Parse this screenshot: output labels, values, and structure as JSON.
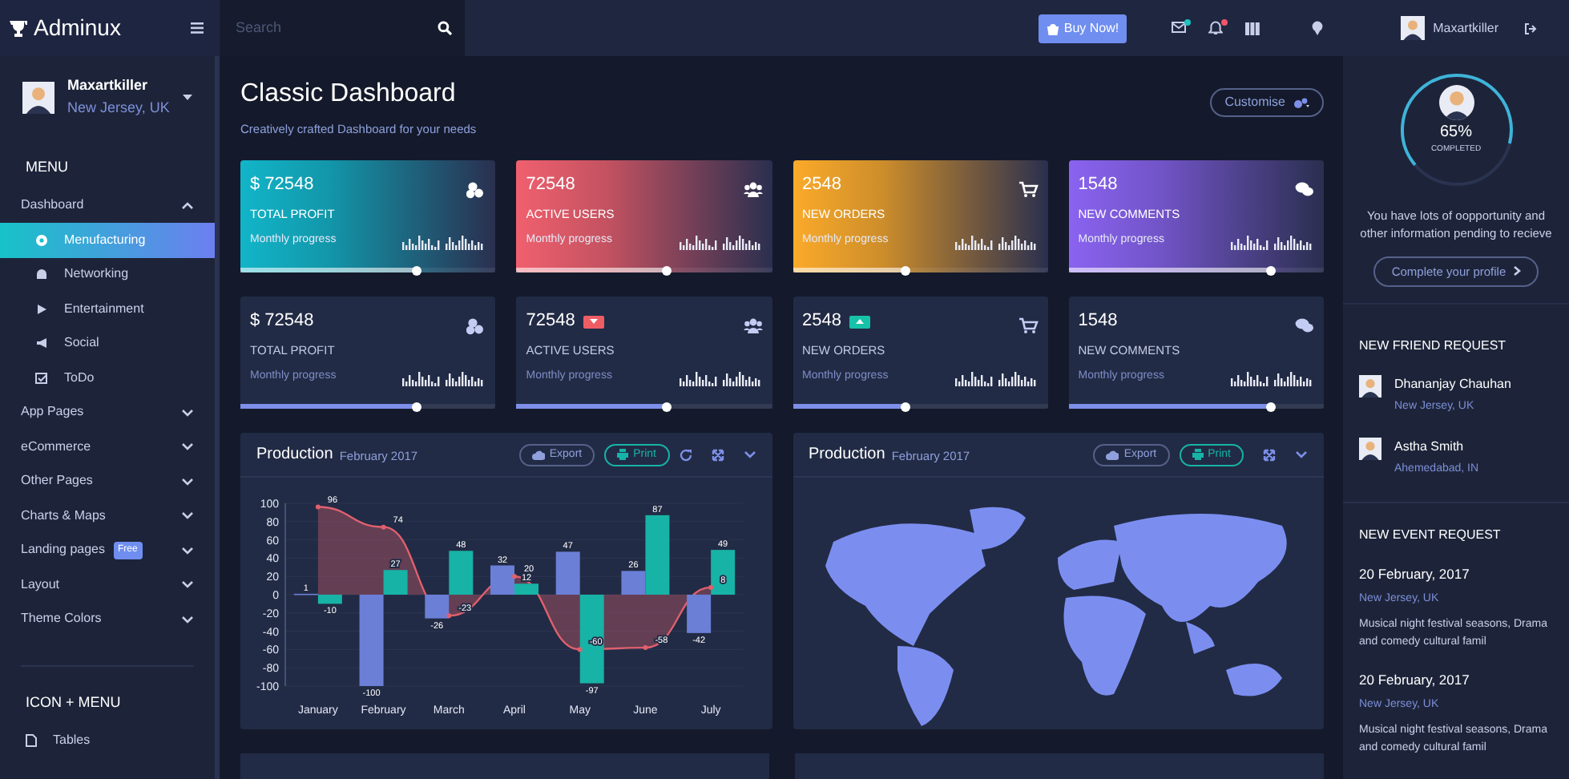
{
  "topbar": {
    "brand": "Adminux",
    "search": {
      "placeholder": "Search"
    },
    "buy_button": "Buy Now!",
    "notifications": [
      {
        "color": "#1bc5bd"
      },
      {
        "color": "#f0556a"
      }
    ],
    "user": "Maxartkiller"
  },
  "sidebar": {
    "user": {
      "name": "Maxartkiller",
      "location": "New Jersey, UK"
    },
    "menu_title": "MENU",
    "items": [
      {
        "label": "Dashboard",
        "expanded": true,
        "children": [
          {
            "label": "Menufacturing",
            "selected": true
          },
          {
            "label": "Networking",
            "selected": false
          },
          {
            "label": "Entertainment",
            "selected": false
          },
          {
            "label": "Social",
            "selected": false
          },
          {
            "label": "ToDo",
            "selected": false
          }
        ]
      },
      {
        "label": "App Pages",
        "expanded": false
      },
      {
        "label": "eCommerce",
        "expanded": false
      },
      {
        "label": "Other Pages",
        "expanded": false
      },
      {
        "label": "Charts & Maps",
        "expanded": false
      },
      {
        "label": "Landing pages",
        "badge": "Free",
        "expanded": false
      },
      {
        "label": "Layout",
        "expanded": false
      },
      {
        "label": "Theme Colors",
        "expanded": false
      }
    ],
    "section_title": "ICON + MENU",
    "icon_items": [
      {
        "label": "Tables"
      }
    ]
  },
  "header": {
    "title": "Classic Dashboard",
    "subtitle": "Creatively crafted Dashboard for your needs",
    "customise_button": "Customise"
  },
  "stats": [
    {
      "kind": "gradient",
      "color": "#12b5c9",
      "value": "$ 72548",
      "label": "TOTAL PROFIT",
      "progress_label": "Monthly progress",
      "level": 0.69
    },
    {
      "kind": "gradient",
      "color": "#f0606e",
      "value": "72548",
      "label": "ACTIVE USERS",
      "progress_label": "Monthly progress",
      "level": 0.59
    },
    {
      "kind": "gradient",
      "color": "#fbaa2a",
      "value": "2548",
      "label": "NEW ORDERS",
      "progress_label": "Monthly progress",
      "level": 0.44
    },
    {
      "kind": "gradient",
      "color": "#8a63f0",
      "value": "1548",
      "label": "NEW COMMENTS",
      "progress_label": "Monthly progress",
      "level": 0.79
    },
    {
      "kind": "plain",
      "value": "$ 72548",
      "label": "TOTAL PROFIT",
      "progress_label": "Monthly progress",
      "level": 0.69
    },
    {
      "kind": "plain",
      "value": "72548",
      "rising": false,
      "label": "ACTIVE USERS",
      "progress_label": "Monthly progress",
      "level": 0.59
    },
    {
      "kind": "plain",
      "value": "2548",
      "rising": true,
      "label": "NEW ORDERS",
      "progress_label": "Monthly progress",
      "level": 0.44
    },
    {
      "kind": "plain",
      "value": "1548",
      "label": "NEW COMMENTS",
      "progress_label": "Monthly progress",
      "level": 0.79
    }
  ],
  "panels": [
    {
      "kind": "chart",
      "title": "Production",
      "subtitle": "February 2017",
      "export_button": "Export",
      "print_button": "Print",
      "chart_data": {
        "type": "bar",
        "categories": [
          "January",
          "February",
          "March",
          "April",
          "May",
          "June",
          "July"
        ],
        "ylim": [
          -100,
          100
        ],
        "yticks": [
          -100,
          -80,
          -60,
          -40,
          -20,
          0,
          20,
          40,
          60,
          80,
          100
        ],
        "data_labels": true,
        "grid": true,
        "series": [
          {
            "color": "#6b7fd6",
            "values": [
              1,
              -100,
              -26,
              32,
              47,
              26,
              -42
            ]
          },
          {
            "color": "#17b3a6",
            "values": [
              -10,
              27,
              48,
              12,
              -97,
              87,
              49
            ]
          },
          {
            "type": "area",
            "color": "#e0606e",
            "values": [
              96,
              74,
              -23,
              20,
              -60,
              -58,
              8
            ]
          }
        ]
      }
    },
    {
      "kind": "map",
      "title": "Production",
      "subtitle": "February 2017",
      "export_button": "Export",
      "print_button": "Print"
    }
  ],
  "profile": {
    "level": 0.65,
    "percent": "65%",
    "caption": "COMPLETED",
    "text": "You have lots of oopportunity and other information pending to recieve",
    "button": "Complete your profile"
  },
  "friend_requests": {
    "title": "NEW FRIEND REQUEST",
    "items": [
      {
        "name": "Dhananjay Chauhan",
        "location": "New Jersey, UK"
      },
      {
        "name": "Astha Smith",
        "location": "Ahemedabad, IN"
      }
    ]
  },
  "event_requests": {
    "title": "NEW EVENT REQUEST",
    "items": [
      {
        "date": "20 February, 2017",
        "location": "New Jersey, UK",
        "text": "Musical night festival seasons, Drama and comedy cultural famil"
      },
      {
        "date": "20 February, 2017",
        "location": "New Jersey, UK",
        "text": "Musical night festival seasons, Drama and comedy cultural famil"
      }
    ]
  }
}
